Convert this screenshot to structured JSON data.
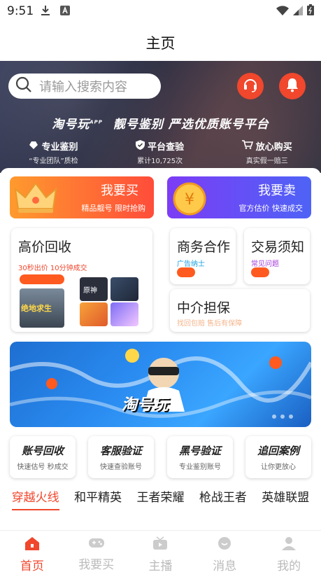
{
  "status_bar": {
    "time": "9:51"
  },
  "header": {
    "title": "主页"
  },
  "search": {
    "placeholder": "请输入搜索内容"
  },
  "hero": {
    "logo": "淘号玩",
    "logo_sup": "APP",
    "slogan": "靓号鉴别 严选优质账号平台",
    "features": [
      {
        "title": "专业鉴别",
        "sub": "“专业团队”质检"
      },
      {
        "title": "平台查验",
        "sub": "累计10,725次"
      },
      {
        "title": "放心购买",
        "sub": "真实假一赔三"
      }
    ]
  },
  "trade": {
    "buy": {
      "title": "我要买",
      "sub": "精品靓号 限时抢购"
    },
    "sell": {
      "title": "我要卖",
      "sub": "官方估价 快速成交"
    }
  },
  "cards": {
    "recycle": {
      "title": "高价回收",
      "sub": "30秒出价 10分钟成交"
    },
    "business": {
      "title": "商务合作",
      "sub": "广告纳士"
    },
    "notice": {
      "title": "交易须知",
      "sub": "常见问题"
    },
    "escrow": {
      "title": "中介担保",
      "sub": "找回包赔 售后有保障"
    }
  },
  "game_thumbs": {
    "pubg": "绝地求生",
    "yuanshen": "原神"
  },
  "banner": {
    "text": "淘号玩"
  },
  "services": [
    {
      "title": "账号回收",
      "sub": "快速估号 秒成交"
    },
    {
      "title": "客服验证",
      "sub": "快速查验账号"
    },
    {
      "title": "黑号验证",
      "sub": "专业鉴别账号"
    },
    {
      "title": "追回案例",
      "sub": "让你更放心"
    }
  ],
  "game_tabs": [
    "穿越火线",
    "和平精英",
    "王者荣耀",
    "枪战王者",
    "英雄联盟"
  ],
  "bottom_nav": [
    {
      "label": "首页",
      "icon": "home-icon"
    },
    {
      "label": "我要买",
      "icon": "gamepad-icon"
    },
    {
      "label": "主播",
      "icon": "tv-icon"
    },
    {
      "label": "消息",
      "icon": "message-icon"
    },
    {
      "label": "我的",
      "icon": "user-icon"
    }
  ],
  "colors": {
    "accent": "#f0472d",
    "buy_gradient": "#ff9a2e",
    "sell_gradient": "#7c3cf5"
  }
}
